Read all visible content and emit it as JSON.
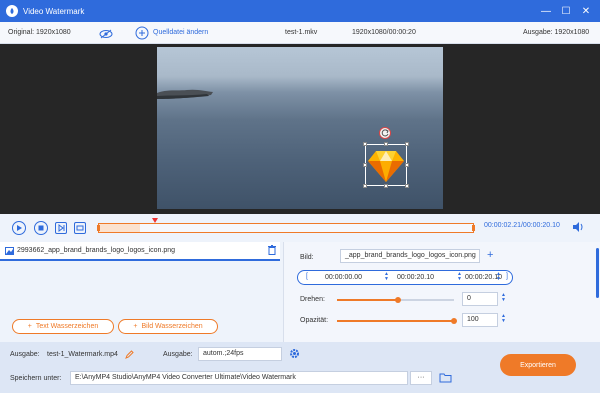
{
  "window": {
    "title": "Video Watermark",
    "minimize": "—",
    "maximize": "☐",
    "close": "✕"
  },
  "info": {
    "original": "Original: 1920x1080",
    "source_change": "Quelldatei ändern",
    "filename": "test-1.mkv",
    "resolution_duration": "1920x1080/00:00:20",
    "output": "Ausgabe: 1920x1080"
  },
  "playback": {
    "time": "00:00:02.21/00:00:20.10",
    "progress_fraction": 0.11
  },
  "watermark_list": {
    "file": "2993662_app_brand_brands_logo_logos_icon.png"
  },
  "buttons": {
    "add_text": "Text Wasserzeichen",
    "add_image": "Bild Wasserzeichen",
    "export": "Exportieren"
  },
  "settings": {
    "image_label": "Bild:",
    "image_value": "_app_brand_brands_logo_logos_icon.png",
    "start_time": "00:00:00.00",
    "end_time": "00:00:20.10",
    "duration": "00:00:20.10",
    "rotate_label": "Drehen:",
    "rotate_value": "0",
    "rotate_fraction": 0.52,
    "opacity_label": "Opazität:",
    "opacity_value": "100",
    "opacity_fraction": 1.0
  },
  "output": {
    "label": "Ausgabe:",
    "file": "test-1_Watermark.mp4",
    "format_label": "Ausgabe:",
    "format_value": "autom.;24fps",
    "save_label": "Speichern unter:",
    "save_path": "E:\\AnyMP4 Studio\\AnyMP4 Video Converter Ultimate\\Video Watermark",
    "more": "···"
  },
  "colors": {
    "accent": "#2f6bdc",
    "orange": "#ef7a28"
  }
}
